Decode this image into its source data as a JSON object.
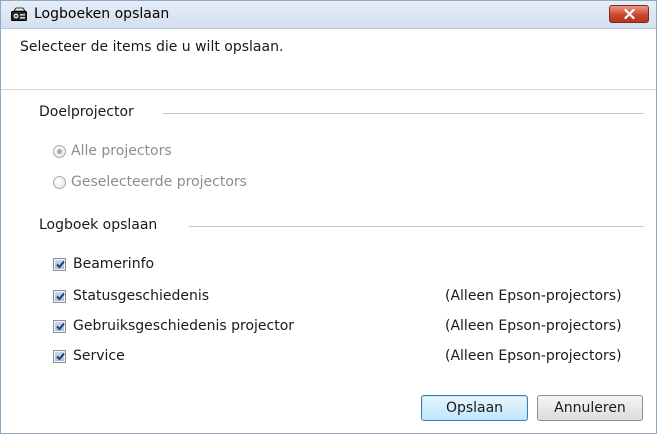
{
  "window": {
    "title": "Logboeken opslaan",
    "icon": "projector-app-icon",
    "close_icon": "close-icon"
  },
  "instruction": "Selecteer de items die u wilt opslaan.",
  "target_group": {
    "label": "Doelprojector",
    "options": [
      {
        "label": "Alle projectors",
        "selected": true,
        "enabled": false
      },
      {
        "label": "Geselecteerde projectors",
        "selected": false,
        "enabled": false
      }
    ]
  },
  "log_group": {
    "label": "Logboek opslaan",
    "items": [
      {
        "label": "Beamerinfo",
        "checked": true,
        "note": ""
      },
      {
        "label": "Statusgeschiedenis",
        "checked": true,
        "note": "(Alleen Epson-projectors)"
      },
      {
        "label": "Gebruiksgeschiedenis projector",
        "checked": true,
        "note": "(Alleen Epson-projectors)"
      },
      {
        "label": "Service",
        "checked": true,
        "note": "(Alleen Epson-projectors)"
      }
    ]
  },
  "buttons": {
    "save": "Opslaan",
    "cancel": "Annuleren"
  },
  "colors": {
    "title_bar": "#dbe6f2",
    "close_button": "#c9472f",
    "primary_button_border": "#3c7fb1",
    "disabled_text": "#8d8d8d"
  }
}
